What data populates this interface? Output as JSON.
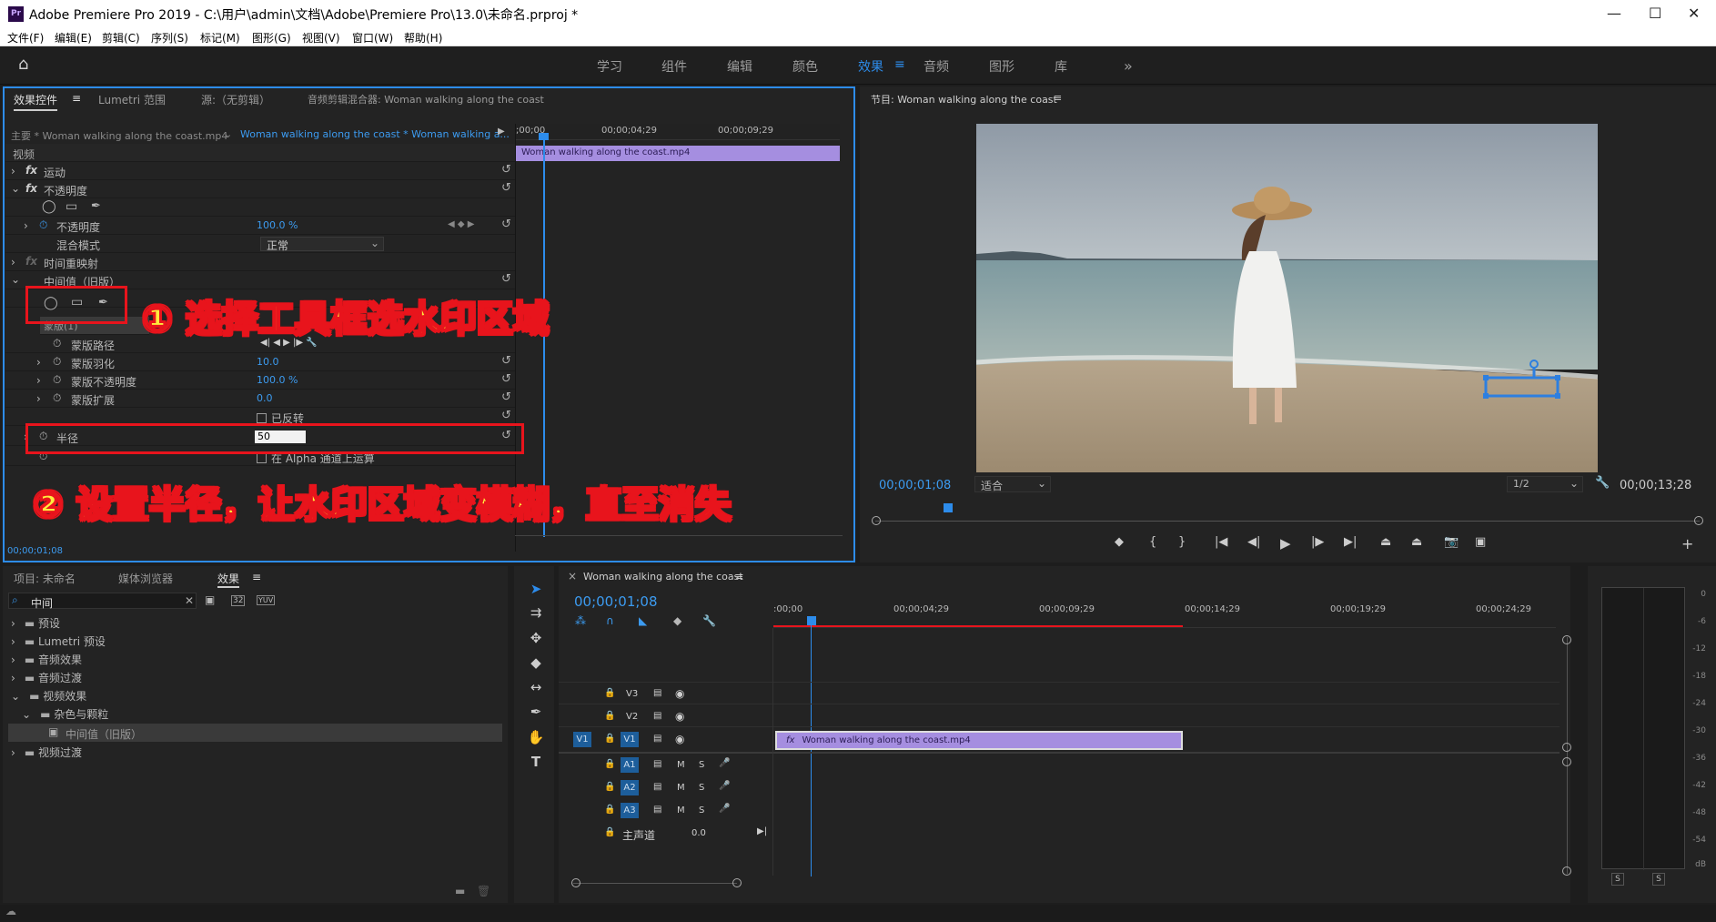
{
  "window": {
    "title": "Adobe Premiere Pro 2019 - C:\\用户\\admin\\文档\\Adobe\\Premiere Pro\\13.0\\未命名.prproj *",
    "logo": "Pr",
    "min": "—",
    "max": "☐",
    "close": "✕"
  },
  "menu": [
    "文件(F)",
    "编辑(E)",
    "剪辑(C)",
    "序列(S)",
    "标记(M)",
    "图形(G)",
    "视图(V)",
    "窗口(W)",
    "帮助(H)"
  ],
  "workspaces": [
    "学习",
    "组件",
    "编辑",
    "颜色",
    "效果",
    "音频",
    "图形",
    "库"
  ],
  "workspace_active": "效果",
  "workspace_menu_glyph": "≡",
  "workspace_more": "»",
  "effect_controls": {
    "tabs": [
      "效果控件",
      "Lumetri 范围",
      "源:（无剪辑）",
      "音频剪辑混合器: Woman walking along the coast"
    ],
    "tab_menu_glyph": "≡",
    "master": "主要 * Woman walking along the coast.mp4",
    "sequence_clip": "Woman walking along the coast * Woman walking a...",
    "section": "视频",
    "fx_badge": "fx",
    "motion": "运动",
    "opacity": "不透明度",
    "opacity_param": "不透明度",
    "opacity_value": "100.0 %",
    "blend_label": "混合模式",
    "blend_value": "正常",
    "time_remap": "时间重映射",
    "median": "中间值（旧版）",
    "mask": "蒙版(1)",
    "mask_path": "蒙版路径",
    "mask_feather": "蒙版羽化",
    "mask_feather_value": "10.0",
    "mask_opacity": "蒙版不透明度",
    "mask_opacity_value": "100.0 %",
    "mask_expand": "蒙版扩展",
    "mask_expand_value": "0.0",
    "inverted": "已反转",
    "radius": "半径",
    "radius_value": "50",
    "alpha": "在 Alpha 通道上运算",
    "timecode": "00;00;01;08",
    "ruler": [
      ";00;00",
      "00;00;04;29",
      "00;00;09;29"
    ],
    "clip_name": "Woman walking along the coast.mp4"
  },
  "annotations": {
    "step1": "① 选择工具框选水印区域",
    "step2": "② 设置半径，让水印区域变模糊，直至消失"
  },
  "program": {
    "title": "节目: Woman walking along the coast",
    "menu_glyph": "≡",
    "timecode": "00;00;01;08",
    "fit": "适合",
    "resolution": "1/2",
    "duration": "00;00;13;28",
    "add_glyph": "+"
  },
  "project": {
    "tabs": [
      "项目: 未命名",
      "媒体浏览器",
      "效果"
    ],
    "tab_menu_glyph": "≡",
    "search_value": "中间",
    "search_clear": "✕",
    "toolbar": [
      "32",
      "YUV"
    ],
    "tree": [
      "预设",
      "Lumetri 预设",
      "音频效果",
      "音频过渡",
      "视频效果",
      "杂色与颗粒",
      "中间值（旧版）",
      "视频过渡"
    ]
  },
  "timeline": {
    "tab_close": "×",
    "title": "Woman walking along the coast",
    "menu_glyph": "≡",
    "timecode": "00;00;01;08",
    "ruler": [
      ":00;00",
      "00;00;04;29",
      "00;00;09;29",
      "00;00;14;29",
      "00;00;19;29",
      "00;00;24;29"
    ],
    "video_tracks": [
      "V3",
      "V2",
      "V1"
    ],
    "source_patch": "V1",
    "audio_tracks": [
      "A1",
      "A2",
      "A3"
    ],
    "mute": "M",
    "solo": "S",
    "master": "主声道",
    "master_value": "0.0",
    "clip_fx": "fx",
    "clip_name": "Woman walking along the coast.mp4"
  },
  "meter": {
    "scale": [
      "0",
      "-6",
      "-12",
      "-18",
      "-24",
      "-30",
      "-36",
      "-42",
      "-48",
      "-54",
      "dB"
    ],
    "solo": [
      "S",
      "S"
    ]
  },
  "colors": {
    "accent": "#2d8ceb",
    "clip": "#a58ee0",
    "annotation_box": "#e8141c",
    "annotation_text": "#ffec3d"
  }
}
